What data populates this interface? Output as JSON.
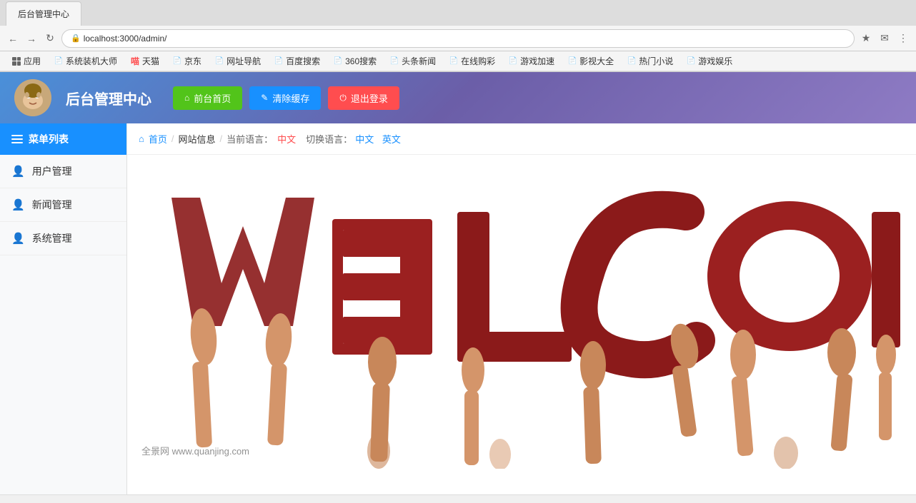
{
  "browser": {
    "url": "localhost:3000/admin/",
    "back_btn": "←",
    "forward_btn": "→",
    "refresh_btn": "↺",
    "lock_icon": "🔒"
  },
  "bookmarks": [
    {
      "label": "应用",
      "icon": "grid"
    },
    {
      "label": "系统装机大师",
      "icon": "doc"
    },
    {
      "label": "天猫",
      "icon": "doc"
    },
    {
      "label": "京东",
      "icon": "doc"
    },
    {
      "label": "网址导航",
      "icon": "doc"
    },
    {
      "label": "百度搜索",
      "icon": "doc"
    },
    {
      "label": "360搜索",
      "icon": "doc"
    },
    {
      "label": "头条新闻",
      "icon": "doc"
    },
    {
      "label": "在线购彩",
      "icon": "doc"
    },
    {
      "label": "游戏加速",
      "icon": "doc"
    },
    {
      "label": "影视大全",
      "icon": "doc"
    },
    {
      "label": "热门小说",
      "icon": "doc"
    },
    {
      "label": "游戏娱乐",
      "icon": "doc"
    }
  ],
  "header": {
    "logo_char": "🧑",
    "title": "后台管理中心",
    "btn_frontend": "前台首页",
    "btn_clear": "清除缓存",
    "btn_logout": "退出登录",
    "btn_frontend_icon": "⌂",
    "btn_clear_icon": "✎",
    "btn_logout_icon": "⏻"
  },
  "breadcrumb": {
    "home_icon": "⌂",
    "home_label": "首页",
    "separator1": "/",
    "page_label": "网站信息",
    "separator2": "/",
    "lang_prefix": "当前语言：",
    "lang_current": "中文",
    "lang_switch_prefix": "切换语言：",
    "lang_zh": "中文",
    "lang_en": "英文"
  },
  "sidebar": {
    "header_icon": "menu",
    "header_label": "菜单列表",
    "items": [
      {
        "label": "用户管理",
        "icon": "user"
      },
      {
        "label": "新闻管理",
        "icon": "user"
      },
      {
        "label": "系统管理",
        "icon": "user"
      }
    ]
  },
  "welcome": {
    "watermark": "全景网 www.quanjing.com"
  }
}
